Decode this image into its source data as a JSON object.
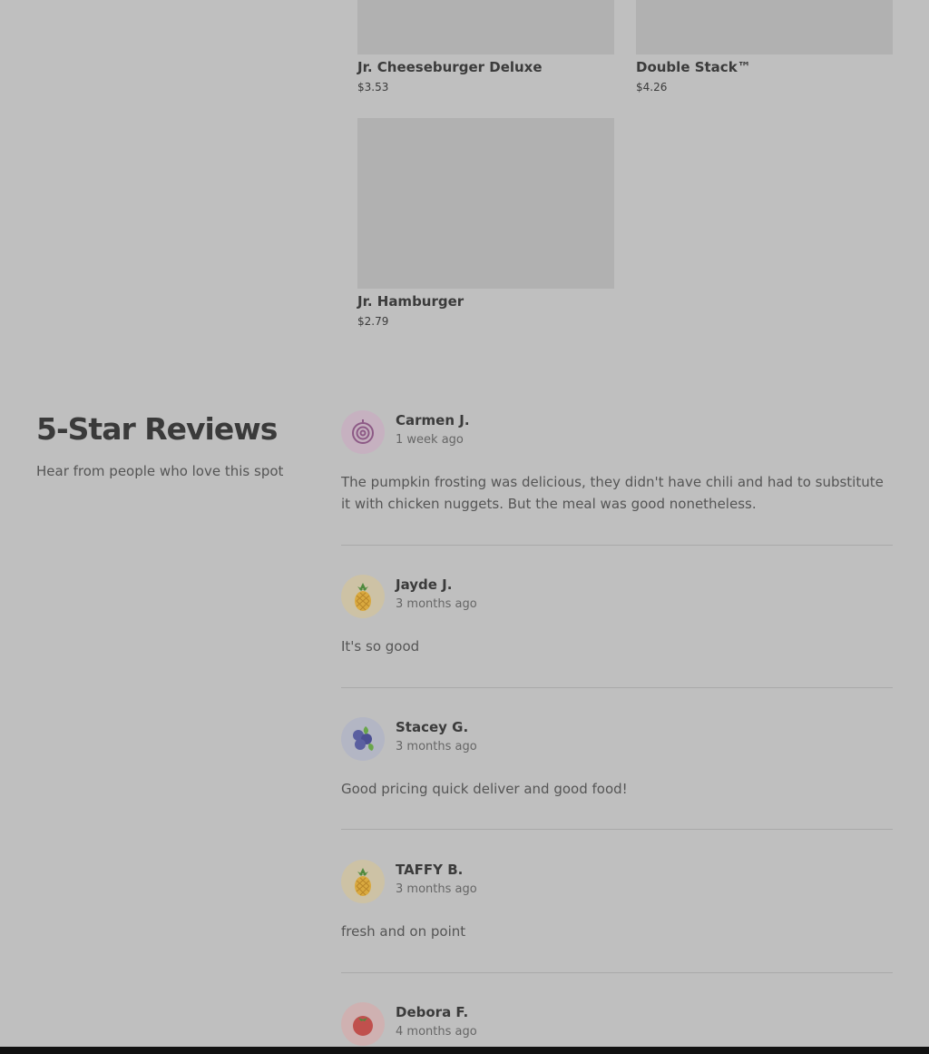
{
  "menu": {
    "items": [
      {
        "name": "Jr. Cheeseburger Deluxe",
        "price": "$3.53"
      },
      {
        "name": "Double Stack™",
        "price": "$4.26"
      },
      {
        "name": "Jr. Hamburger",
        "price": "$2.79"
      }
    ]
  },
  "reviews_section": {
    "title": "5-Star Reviews",
    "subtitle": "Hear from people who love this spot"
  },
  "reviews": [
    {
      "name": "Carmen J.",
      "ago": "1 week ago",
      "text": "The pumpkin frosting was delicious, they didn't have chili and had to substitute it with chicken nuggets. But the meal was good nonetheless.",
      "avatar_icon": "onion-icon"
    },
    {
      "name": "Jayde J.",
      "ago": "3 months ago",
      "text": "It's so good",
      "avatar_icon": "pineapple-icon"
    },
    {
      "name": "Stacey G.",
      "ago": "3 months ago",
      "text": "Good pricing quick deliver and good food!",
      "avatar_icon": "blueberries-icon"
    },
    {
      "name": "TAFFY B.",
      "ago": "3 months ago",
      "text": "fresh and on point",
      "avatar_icon": "pineapple-icon"
    },
    {
      "name": "Debora F.",
      "ago": "4 months ago",
      "text": "",
      "avatar_icon": "tomato-icon"
    }
  ],
  "colors": {
    "overlay_bg": "#bfbfbf",
    "image_placeholder": "#b1b1b1"
  }
}
